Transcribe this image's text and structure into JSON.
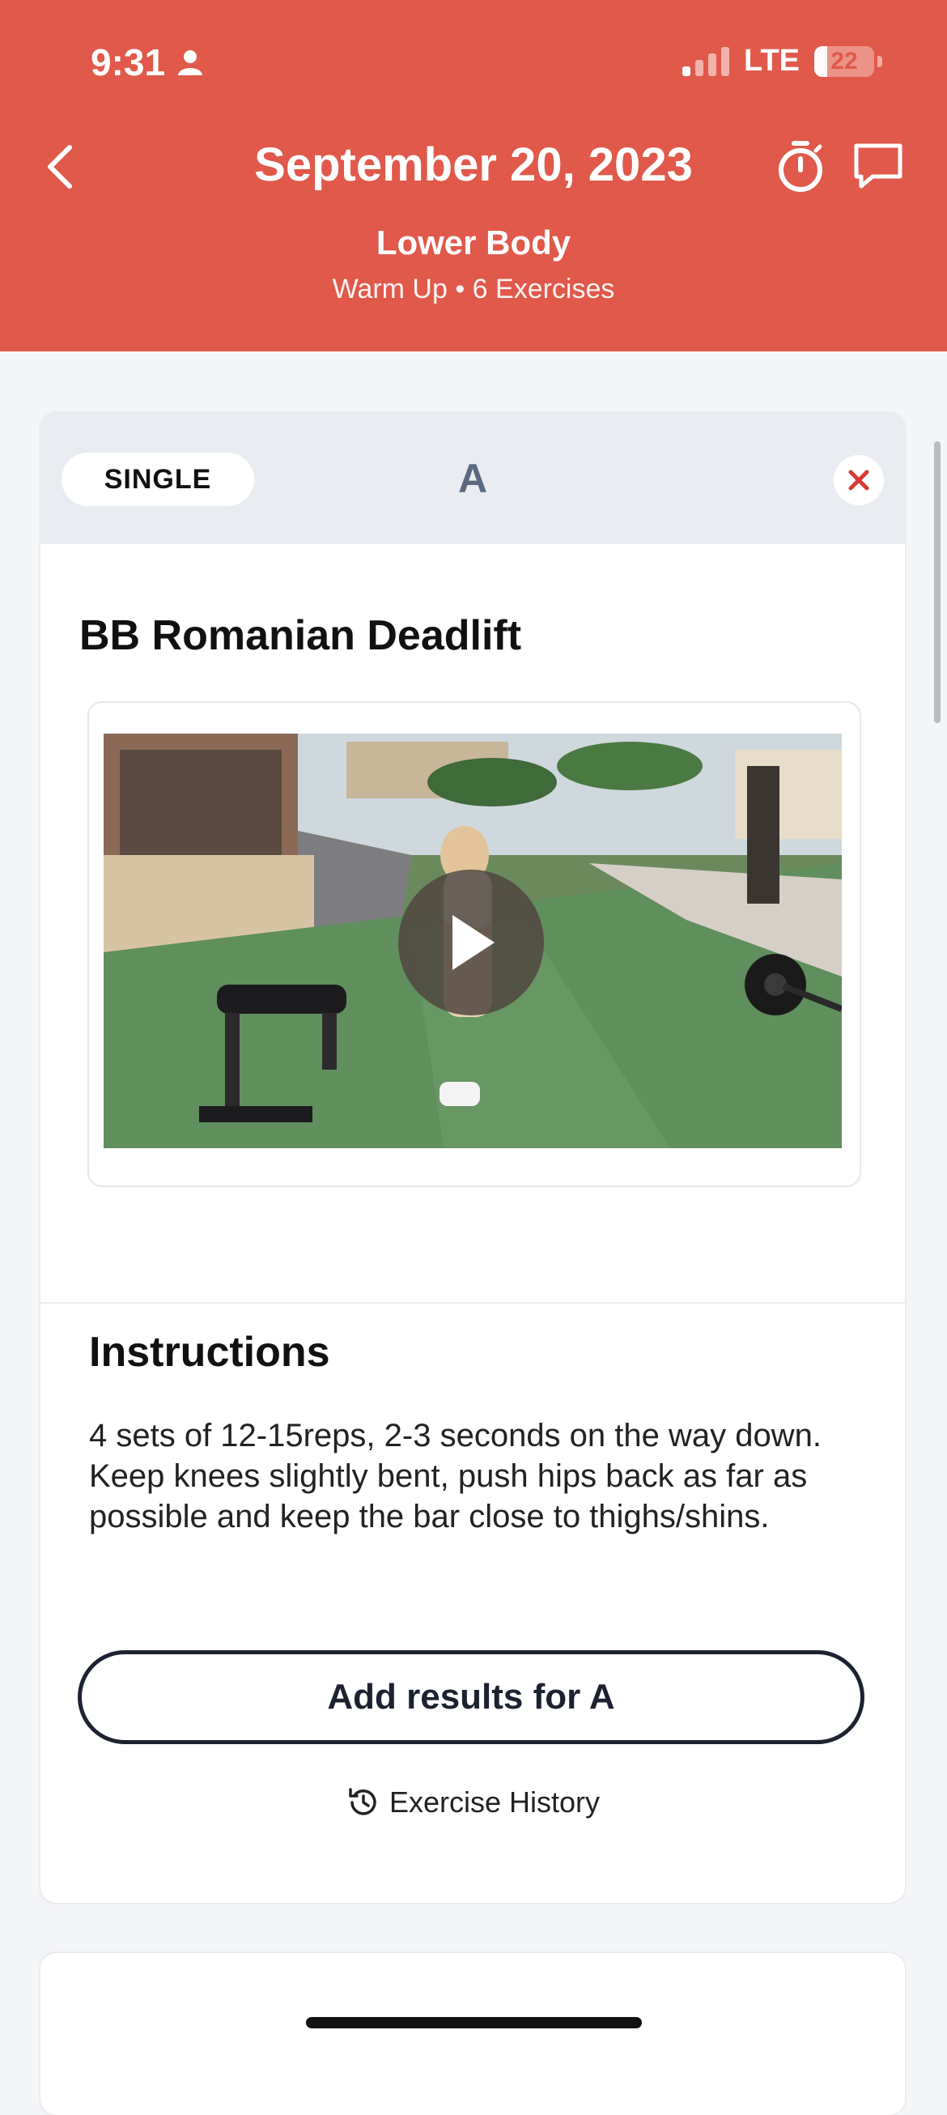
{
  "status": {
    "time": "9:31",
    "network": "LTE",
    "battery": "22",
    "battery_level_pct": 22,
    "signal_bars_on": 1,
    "signal_bars_total": 4
  },
  "nav": {
    "title": "September 20, 2023",
    "back_icon": "chevron-left-icon",
    "timer_icon": "stopwatch-icon",
    "chat_icon": "chat-bubble-icon"
  },
  "workout": {
    "name": "Lower Body",
    "meta": "Warm Up • 6 Exercises"
  },
  "exercise": {
    "type_label": "SINGLE",
    "group": "A",
    "close_icon": "close-icon",
    "title": "BB Romanian Deadlift",
    "play_icon": "play-icon",
    "instructions_title": "Instructions",
    "instructions": "4 sets of 12-15reps, 2-3 seconds on the way down. Keep knees slightly bent, push hips back as far as possible and keep the bar close to thighs/shins.",
    "add_results_label": "Add results for A",
    "history_label": "Exercise History",
    "history_icon": "history-icon"
  },
  "colors": {
    "header": "#e0594a",
    "close": "#d83a3a",
    "group_letter": "#5b6a80"
  }
}
